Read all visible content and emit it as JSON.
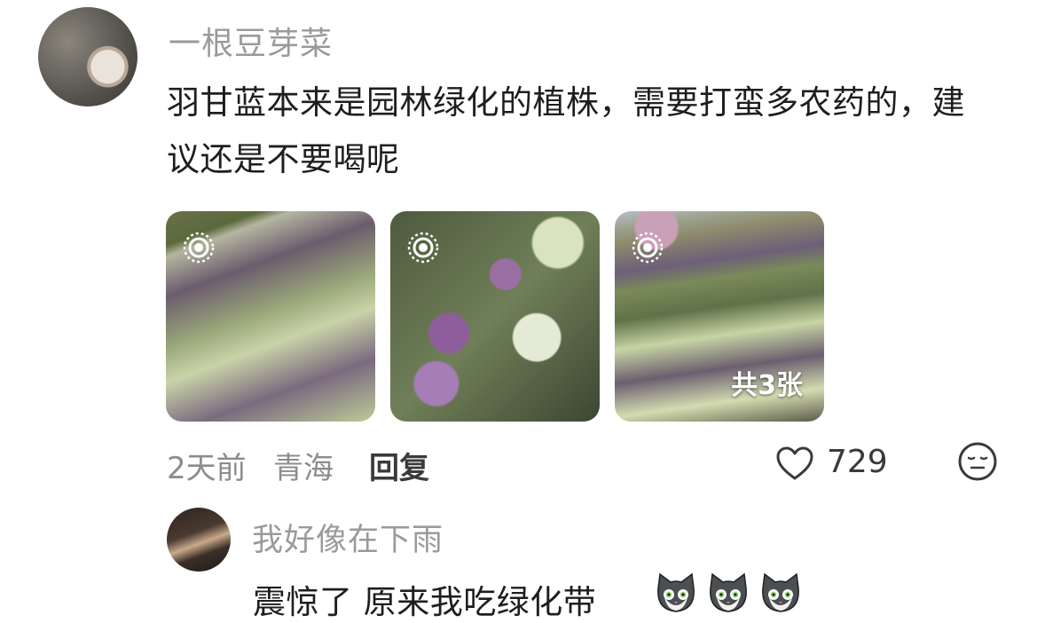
{
  "comment": {
    "username": "一根豆芽菜",
    "text": "羽甘蓝本来是园林绿化的植株，需要打蛮多农药的，建议还是不要喝呢",
    "images": [
      {
        "alt": "flower-field-photo-1"
      },
      {
        "alt": "ornamental-kale-photo-2"
      },
      {
        "alt": "flower-field-photo-3"
      }
    ],
    "image_count_label": "共3张",
    "time": "2天前",
    "location": "青海",
    "reply_label": "回复",
    "likes": "729"
  },
  "sub_reply": {
    "username": "我好像在下雨",
    "text": "震惊了 原来我吃绿化带"
  },
  "icons": [
    "live-photo-icon",
    "heart-icon",
    "emoji-icon",
    "cat-emoji-icon"
  ],
  "colors": {
    "username": "#9a9a9a",
    "text": "#1e1e1e",
    "meta": "#8c8c8c"
  }
}
